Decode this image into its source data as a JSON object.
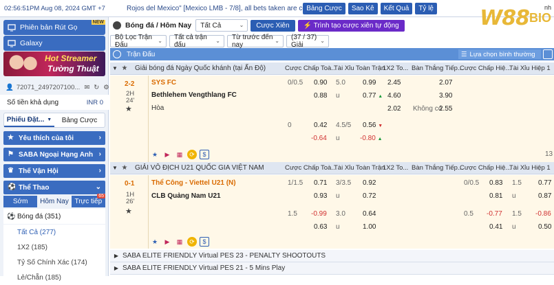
{
  "topbar": {
    "clock": "02:56:51PM Aug 08, 2024 GMT +7",
    "ticker": "Rojos del Mexico\" [Mexico LMB - 7/8], all bets taken are considered",
    "buttons": [
      "Bảng Cược",
      "Sao Kê",
      "Kết Quả",
      "Tỷ lệ"
    ],
    "logo": "W88",
    "logo_suffix": "BIO",
    "logo_overlap": "nh"
  },
  "sidebar": {
    "btn1": "Phiên bản Rút Gọ",
    "btn1_badge": "NEW",
    "btn2": "Galaxy",
    "banner_l1": "Hot Streamer",
    "banner_l2": "Tường Thuật",
    "account": "72071_2497207100...",
    "balance_label": "Số tiền khả dụng",
    "balance_value": "INR 0",
    "tab_slip": "Phiếu Đặt...",
    "tab_bets": "Bảng Cược",
    "cat_fav": "Yêu thích của tôi",
    "cat_saba": "SABA Ngoại Hạng Anh",
    "cat_olympic": "Thế Vận Hội",
    "cat_sports": "Thể Thao",
    "sub_early": "Sớm",
    "sub_today": "Hôm Nay",
    "sub_live": "Trực tiếp",
    "sub_live_count": "65",
    "soccer": "Bóng đá",
    "soccer_count": "(351)",
    "all": "Tất Cả",
    "all_count": "(277)",
    "x12": "1X2",
    "x12_count": "(185)",
    "cs": "Tỷ Số Chính Xác",
    "cs_count": "(174)",
    "oe": "Lẻ/Chẵn",
    "oe_count": "(185)"
  },
  "toolbar": {
    "sport": "Bóng đá / Hôm Nay",
    "filter_all": "Tất Cả",
    "parlay": "Cược Xiên",
    "auto_parlay": "Trình tạo cược xiên tự động",
    "league_filter": "Bộ Lọc Trận Đấu",
    "all_matches": "Tất cả trận đấu",
    "from_now": "Từ trước đến nay",
    "count": "(37 / 37) Giải"
  },
  "header": {
    "title": "Trận Đấu",
    "sort": "Lựa chọn bình thường"
  },
  "columns": [
    "Cược Chấp Toà...",
    "Tài Xỉu Toàn Trận",
    "1X2 To...",
    "Bàn Thắng Tiếp...",
    "Cược Chấp Hiệ...",
    "Tài Xỉu Hiệp 1"
  ],
  "league1": {
    "name": "Giải bóng đá Ngày Quốc khánh (tại Ấn Độ)"
  },
  "match1": {
    "score": "2-2",
    "half": "2H",
    "min": "24'",
    "home": "SYS FC",
    "away": "Bethlehem Vengthlang FC",
    "draw": "Hòa",
    "hdp_line": "0/0.5",
    "hdp_home": "0.90",
    "hdp_away": "0.88",
    "ou_line": "5.0",
    "ou_over": "0.99",
    "ou_u": "u",
    "ou_under": "0.77",
    "x1": "2.45",
    "x2": "4.60",
    "xd": "2.02",
    "ng1": "2.07",
    "ng2": "3.90",
    "ng_none": "Không có",
    "ng_none_v": "2.55",
    "hdp2_line": "0",
    "hdp2_home": "0.42",
    "hdp2_away": "-0.64",
    "ou2_line": "4.5/5",
    "ou2_over": "0.56",
    "ou2_u": "u",
    "ou2_under": "-0.80",
    "page": "13"
  },
  "league2": {
    "name": "GIẢI VÔ ĐỊCH U21 QUỐC GIA VIỆT NAM"
  },
  "match2": {
    "score": "0-1",
    "half": "1H",
    "min": "26'",
    "home": "Thể Công - Viettel U21 (N)",
    "away": "CLB Quảng Nam U21",
    "hdp_line": "1/1.5",
    "hdp_home": "0.71",
    "hdp_away": "0.93",
    "ou_line": "3/3.5",
    "ou_over": "0.92",
    "ou_u": "u",
    "ou_under": "0.72",
    "hdp2_line": "1.5",
    "hdp2_home": "-0.99",
    "hdp2_away": "0.63",
    "ou2_line": "3.0",
    "ou2_over": "0.64",
    "ou2_u": "u",
    "ou2_under": "1.00",
    "fh_line": "0/0.5",
    "fh_home": "0.83",
    "fh_away": "0.81",
    "fh_ou_line": "1.5",
    "fh_over": "0.77",
    "fh_u": "u",
    "fh_under": "0.87",
    "fh2_line": "0.5",
    "fh2_home": "-0.77",
    "fh2_away": "0.41",
    "fh2_ou_line": "1.5",
    "fh2_over": "-0.86",
    "fh2_u": "u",
    "fh2_under": "0.50"
  },
  "group3": "SABA ELITE FRIENDLY Virtual PES 23 - PENALTY SHOOTOUTS",
  "group4": "SABA ELITE FRIENDLY Virtual PES 21 - 5 Mins Play",
  "colors": {
    "accent": "#2b5db3",
    "header": "#5b8fd6",
    "fav": "#d96a00",
    "neg": "#d03030",
    "pos": "#1a9a3a"
  }
}
